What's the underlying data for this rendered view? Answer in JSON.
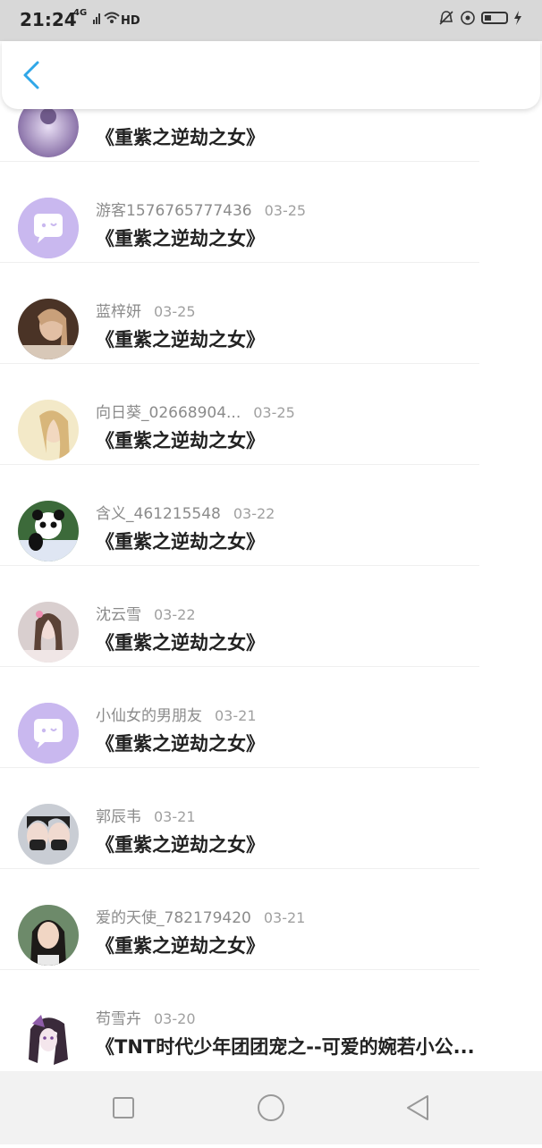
{
  "status_bar": {
    "time": "21:24",
    "network": "4G",
    "hd": "HD"
  },
  "list": [
    {
      "user": "",
      "date": "",
      "title": "《重紫之逆劫之女》",
      "avatar": "photo-purple"
    },
    {
      "user": "游客1576765777436",
      "date": "03-25",
      "title": "《重紫之逆劫之女》",
      "avatar": "default"
    },
    {
      "user": "蓝梓妍",
      "date": "03-25",
      "title": "《重紫之逆劫之女》",
      "avatar": "photo-brown"
    },
    {
      "user": "向日葵_02668904...",
      "date": "03-25",
      "title": "《重紫之逆劫之女》",
      "avatar": "photo-cream"
    },
    {
      "user": "含义_461215548",
      "date": "03-22",
      "title": "《重紫之逆劫之女》",
      "avatar": "photo-panda"
    },
    {
      "user": "沈云雪",
      "date": "03-22",
      "title": "《重紫之逆劫之女》",
      "avatar": "photo-pink"
    },
    {
      "user": "小仙女的男朋友",
      "date": "03-21",
      "title": "《重紫之逆劫之女》",
      "avatar": "default"
    },
    {
      "user": "郭辰韦",
      "date": "03-21",
      "title": "《重紫之逆劫之女》",
      "avatar": "photo-masks"
    },
    {
      "user": "爱的天使_782179420",
      "date": "03-21",
      "title": "《重紫之逆劫之女》",
      "avatar": "photo-girl"
    },
    {
      "user": "苟雪卉",
      "date": "03-20",
      "title": "《TNT时代少年团团宠之--可爱的婉若小公...",
      "avatar": "photo-anime"
    }
  ],
  "colors": {
    "accent": "#2fa7e8",
    "default_avatar": "#c9b8ef",
    "status_bar": "#d8d8d8"
  },
  "icons": {
    "back": "chevron-left-icon",
    "nav_recent": "square-icon",
    "nav_home": "circle-icon",
    "nav_back": "triangle-icon"
  }
}
